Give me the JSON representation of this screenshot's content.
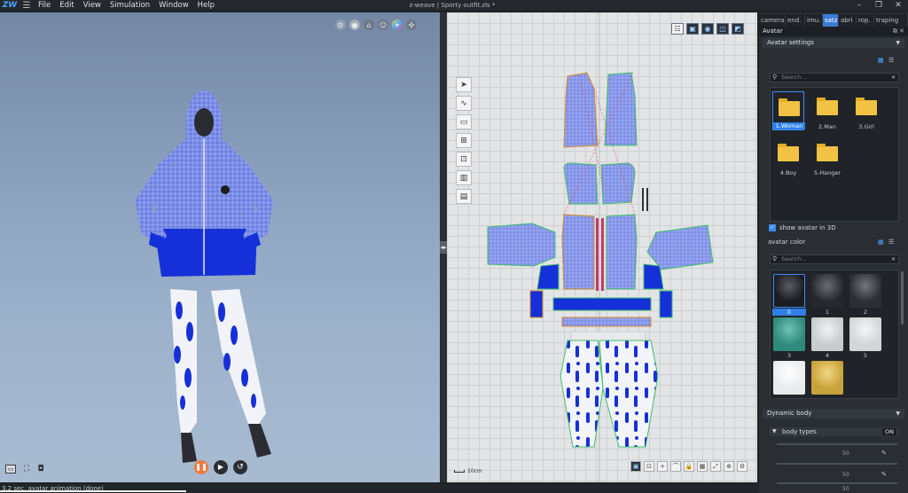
{
  "app": {
    "logo": "ZW",
    "menu": [
      "File",
      "Edit",
      "View",
      "Simulation",
      "Window",
      "Help"
    ],
    "title": "z-weave | Sporty outfit.zls *",
    "window_controls": [
      "–",
      "❐",
      "✕"
    ]
  },
  "viewport3d": {
    "toolbar_icons": [
      "settings-icon",
      "sphere-icon",
      "hanger-icon",
      "avatar-icon",
      "texture-icon",
      "axis-icon"
    ],
    "bottom_left_icons": [
      "screenshot-icon",
      "camera-move-icon",
      "camera-icon"
    ],
    "playback": [
      "pause-button",
      "step-button",
      "reset-button"
    ]
  },
  "viewport2d": {
    "scale_label": "10cm",
    "left_tools": [
      "select-tool",
      "curve-tool",
      "rect-tool",
      "pattern-tool",
      "sew-tool",
      "tack-tool",
      "measure-tool"
    ]
  },
  "panel": {
    "tabs": [
      "camera",
      "end.",
      "imu.",
      "satz",
      "abri",
      "rop.",
      "traping"
    ],
    "active_tab": "satz",
    "title": "Avatar",
    "avatar_settings_header": "Avatar settings",
    "settings_search_placeholder": "Search...",
    "folders": [
      {
        "label": "1.Woman",
        "selected": true
      },
      {
        "label": "2.Man",
        "selected": false
      },
      {
        "label": "3.Girl",
        "selected": false
      },
      {
        "label": "4.Boy",
        "selected": false
      },
      {
        "label": "5.Hanger",
        "selected": false
      }
    ],
    "show_avatar_label": "show avatar in 3D",
    "show_avatar_checked": true,
    "avatar_color_label": "avatar color",
    "color_search_placeholder": "Search...",
    "avatar_colors": [
      {
        "label": "0",
        "selected": true,
        "color": "#1a1c20"
      },
      {
        "label": "1",
        "selected": false,
        "color": "#26282c"
      },
      {
        "label": "2",
        "selected": false,
        "color": "#2c2e33"
      },
      {
        "label": "3",
        "selected": false,
        "color": "#2f8a7c"
      },
      {
        "label": "4",
        "selected": false,
        "color": "#c9cbcd"
      },
      {
        "label": "5",
        "selected": false,
        "color": "#d3d5d7"
      },
      {
        "label": "",
        "selected": false,
        "color": "#eaebed"
      },
      {
        "label": "",
        "selected": false,
        "color": "#c8a23a"
      }
    ],
    "dynamic_body_header": "Dynamic body",
    "body_types_label": "body types",
    "body_types_toggle": "ON",
    "slider_values": [
      "50",
      "50",
      "50"
    ]
  },
  "status": {
    "text": "3.2 sec. avatar animation (done)"
  }
}
